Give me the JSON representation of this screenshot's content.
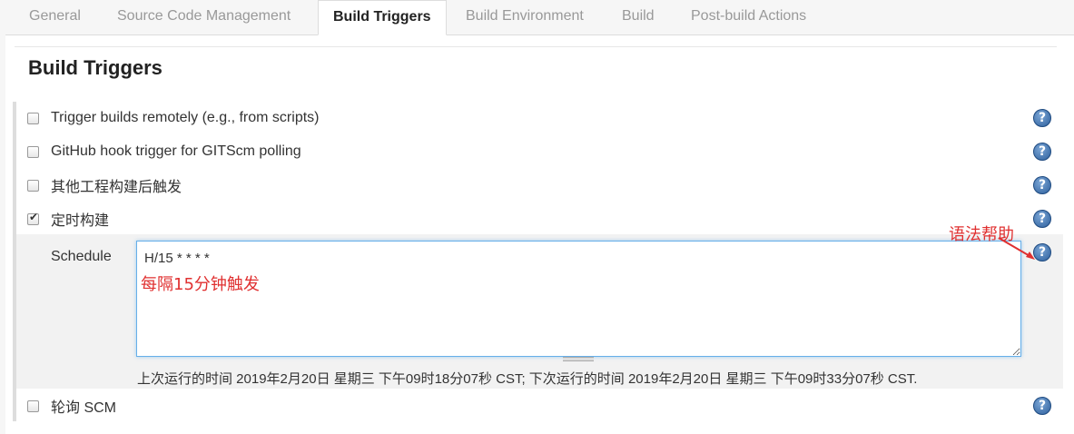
{
  "tabs": [
    {
      "label": "General"
    },
    {
      "label": "Source Code Management"
    },
    {
      "label": "Build Triggers"
    },
    {
      "label": "Build Environment"
    },
    {
      "label": "Build"
    },
    {
      "label": "Post-build Actions"
    }
  ],
  "active_tab": "Build Triggers",
  "section": {
    "title": "Build Triggers"
  },
  "triggers": [
    {
      "label": "Trigger builds remotely (e.g., from scripts)",
      "checked": false
    },
    {
      "label": "GitHub hook trigger for GITScm polling",
      "checked": false
    },
    {
      "label": "其他工程构建后触发",
      "checked": false
    },
    {
      "label": "定时构建",
      "checked": true
    },
    {
      "label": "轮询 SCM",
      "checked": false
    }
  ],
  "schedule": {
    "label": "Schedule",
    "value": "H/15 * * * *",
    "run_info": "上次运行的时间 2019年2月20日 星期三 下午09时18分07秒 CST; 下次运行的时间 2019年2月20日 星期三 下午09时33分07秒 CST."
  },
  "annotations": {
    "syntax_help": "语法帮助",
    "every_15_min": "每隔15分钟触发"
  },
  "help_icon_glyph": "?",
  "colors": {
    "annotation": "#e03030",
    "help_icon": "#2d5f9c",
    "focus_border": "#66afe9"
  }
}
